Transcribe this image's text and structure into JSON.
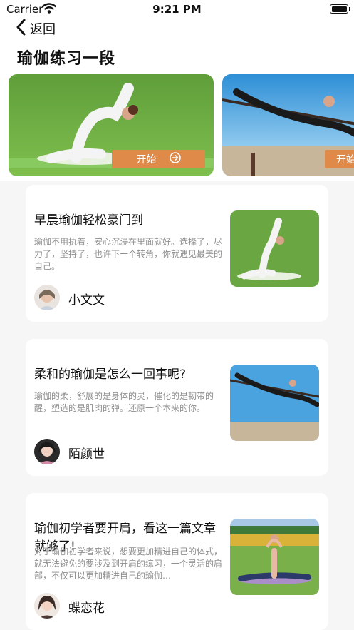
{
  "status_bar": {
    "carrier": "Carrier",
    "time": "9:21 PM"
  },
  "nav": {
    "back_label": "返回"
  },
  "page": {
    "title": "瑜伽练习一段"
  },
  "banners": [
    {
      "button_label": "开始"
    },
    {
      "button_label": "开始"
    }
  ],
  "articles": [
    {
      "title": "早晨瑜伽轻松豪门到",
      "summary": "瑜伽不用执着，安心沉浸在里面就好。选择了，尽力了，坚持了，也许下一个转角，你就遇见最美的自己。",
      "author": "小文文"
    },
    {
      "title": "柔和的瑜伽是怎么一回事呢?",
      "summary": "瑜伽的柔，舒展的是身体的灵，催化的是韧带的醒，塑造的是肌肉的弹。还原一个本来的你。",
      "author": "陌颜世"
    },
    {
      "title": "瑜伽初学者要开肩，看这一篇文章就够了!",
      "summary": "对于瑜伽初学者来说，想要更加精进自己的体式，就无法避免的要涉及到开肩的练习，一个灵活的肩部，不仅可以更加精进自己的瑜伽…",
      "author": "蝶恋花"
    }
  ]
}
